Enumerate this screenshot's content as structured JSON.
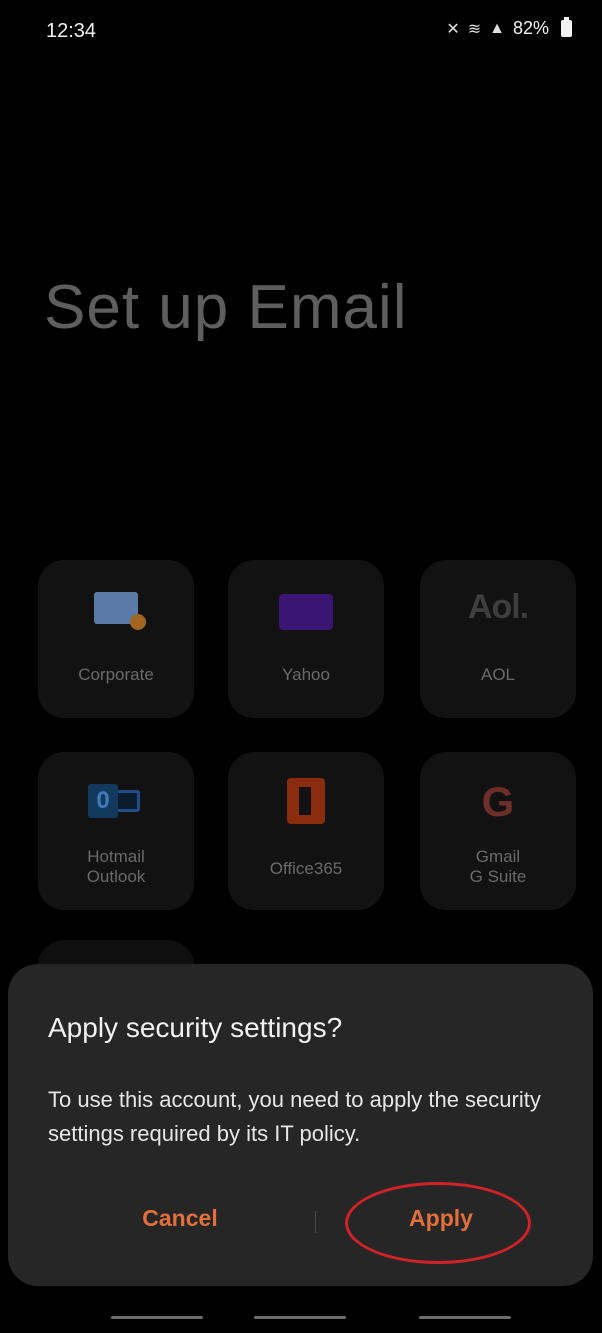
{
  "status": {
    "time": "12:34",
    "battery": "82%"
  },
  "title": "Set up Email",
  "tiles": [
    {
      "label": "Corporate"
    },
    {
      "label": "Yahoo"
    },
    {
      "label": "AOL",
      "icon_text": "Aol."
    },
    {
      "label_line1": "Hotmail",
      "label_line2": "Outlook",
      "icon_text": "0"
    },
    {
      "label": "Office365"
    },
    {
      "label_line1": "Gmail",
      "label_line2": "G Suite",
      "icon_text": "G"
    }
  ],
  "dialog": {
    "title": "Apply security settings?",
    "body": "To use this account, you need to apply the security settings required by its IT policy.",
    "cancel_label": "Cancel",
    "apply_label": "Apply"
  },
  "colors": {
    "accent": "#e36f3b",
    "highlight": "#d1222a",
    "dialog_bg": "#262626"
  }
}
